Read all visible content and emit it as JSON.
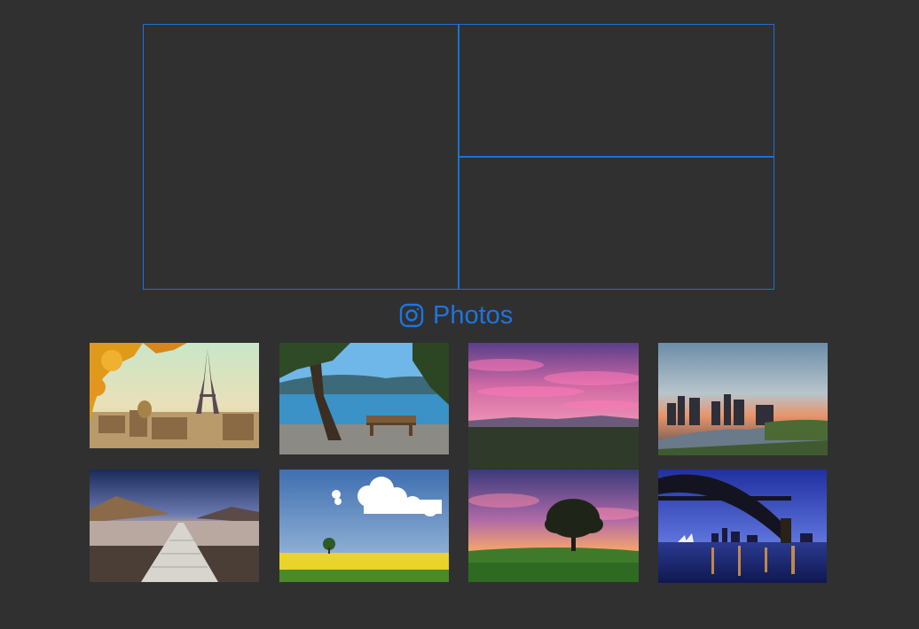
{
  "gallery": {
    "title": "Photos",
    "icon": "instagram-icon",
    "accent_color": "#1e74e0"
  },
  "frames": [
    {
      "name": "featured-frame-left"
    },
    {
      "name": "featured-frame-top-right"
    },
    {
      "name": "featured-frame-bottom-right"
    }
  ],
  "photos": [
    {
      "subject": "eiffel-tower-autumn"
    },
    {
      "subject": "lake-bench-view"
    },
    {
      "subject": "pink-sunset-sky"
    },
    {
      "subject": "city-skyline-river"
    },
    {
      "subject": "lake-pier-dusk"
    },
    {
      "subject": "yellow-field-tree"
    },
    {
      "subject": "tree-sunset-meadow"
    },
    {
      "subject": "harbour-bridge-night"
    }
  ]
}
